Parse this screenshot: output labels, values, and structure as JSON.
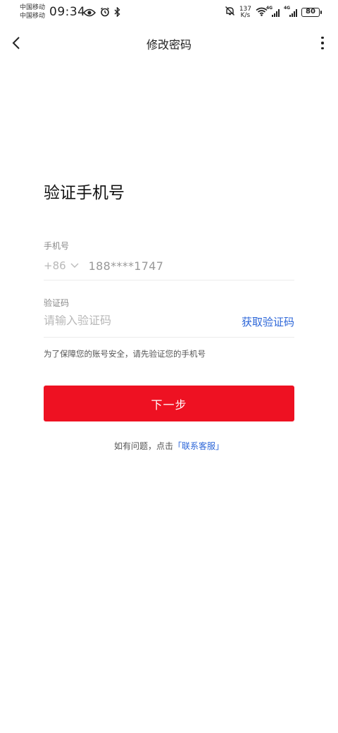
{
  "status_bar": {
    "carrier_1": "中国移动",
    "carrier_2": "中国移动",
    "time": "09:34",
    "net_speed_value": "137",
    "net_speed_unit": "K/s",
    "network_type_1": "4G",
    "network_type_2": "4G",
    "battery": "80"
  },
  "nav": {
    "title": "修改密码"
  },
  "form": {
    "heading": "验证手机号",
    "phone_label": "手机号",
    "country_code": "+86",
    "phone_value": "188****1747",
    "code_label": "验证码",
    "code_placeholder": "请输入验证码",
    "get_code_label": "获取验证码",
    "hint": "为了保障您的账号安全，请先验证您的手机号",
    "next_label": "下一步"
  },
  "help": {
    "prefix": "如有问题，点击",
    "link": "「联系客服」"
  },
  "colors": {
    "primary_red": "#ee1122",
    "link_blue": "#2c66d8"
  }
}
